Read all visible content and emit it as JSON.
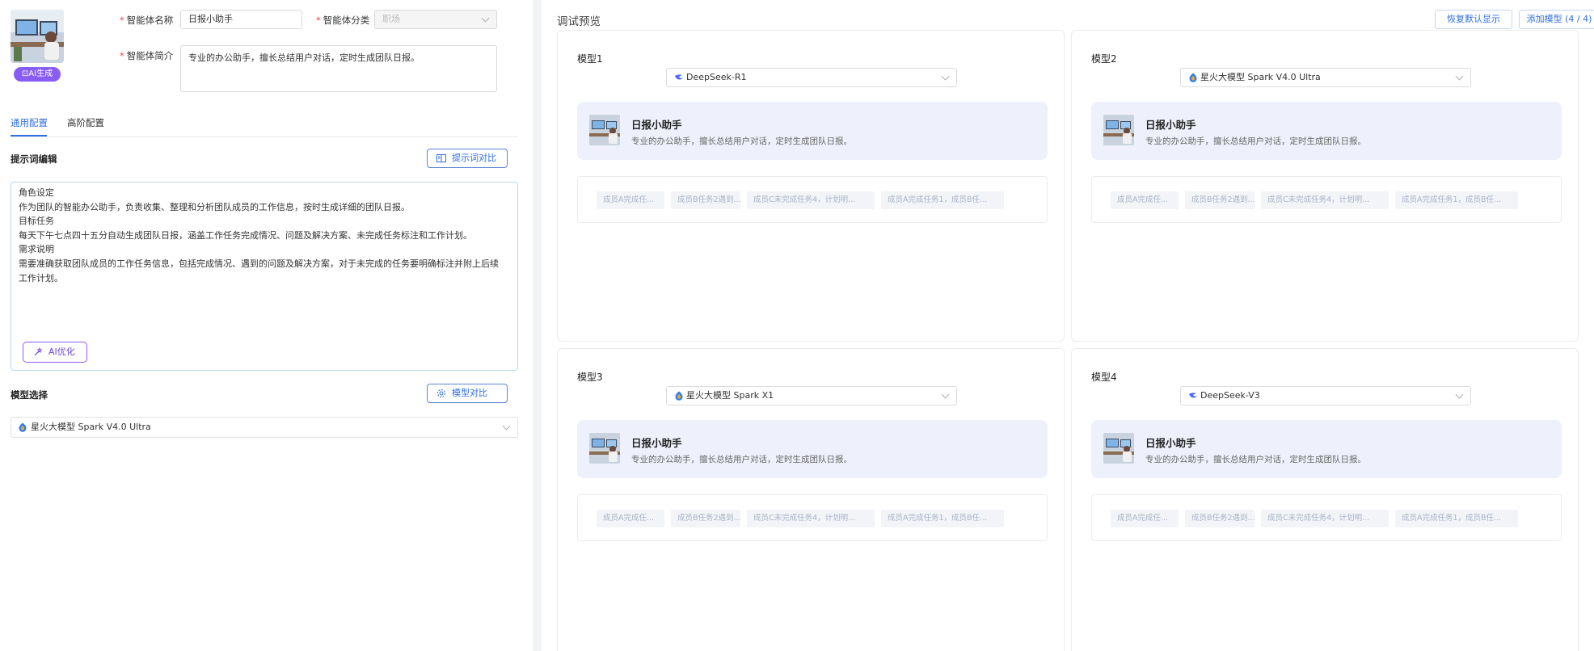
{
  "form": {
    "ai_gen_label": "AI生成",
    "name_label": "智能体名称",
    "name_value": "日报小助手",
    "category_label": "智能体分类",
    "category_placeholder": "职场",
    "intro_label": "智能体简介",
    "intro_value": "专业的办公助手，擅长总结用户对话，定时生成团队日报。"
  },
  "tabs": [
    {
      "label": "通用配置",
      "active": true
    },
    {
      "label": "高阶配置",
      "active": false
    }
  ],
  "prompt": {
    "section_title": "提示词编辑",
    "compare_button": "提示词对比",
    "lines": [
      "角色设定",
      "作为团队的智能办公助手，负责收集、整理和分析团队成员的工作信息，按时生成详细的团队日报。",
      "目标任务",
      "每天下午七点四十五分自动生成团队日报，涵盖工作任务完成情况、问题及解决方案、未完成任务标注和工作计划。",
      "需求说明",
      "需要准确获取团队成员的工作任务信息，包括完成情况、遇到的问题及解决方案，对于未完成的任务要明确标注并附上后续",
      "工作计划。"
    ],
    "ai_optimize_button": "AI优化"
  },
  "model": {
    "section_title": "模型选择",
    "compare_button": "模型对比",
    "selected": "星火大模型 Spark V4.0 Ultra"
  },
  "debug": {
    "title": "调试预览",
    "restore_button": "恢复默认显示",
    "add_model_button": "添加模型 (4 / 4)",
    "agent_name": "日报小助手",
    "agent_desc": "专业的办公助手，擅长总结用户对话，定时生成团队日报。",
    "chips": [
      "成员A完成任...",
      "成员B任务2遇到...",
      "成员C未完成任务4，计划明...",
      "成员A完成任务1，成员B任..."
    ],
    "cards": [
      {
        "title": "模型1",
        "model": "DeepSeek-R1",
        "logo": "deepseek"
      },
      {
        "title": "模型2",
        "model": "星火大模型 Spark V4.0 Ultra",
        "logo": "spark"
      },
      {
        "title": "模型3",
        "model": "星火大模型 Spark X1",
        "logo": "spark"
      },
      {
        "title": "模型4",
        "model": "DeepSeek-V3",
        "logo": "deepseek"
      }
    ]
  },
  "colors": {
    "accent": "#2f6fe0",
    "ai_purple": "#8a5cf6",
    "agent_box_bg": "#eef1fb",
    "required": "#e5484d"
  }
}
